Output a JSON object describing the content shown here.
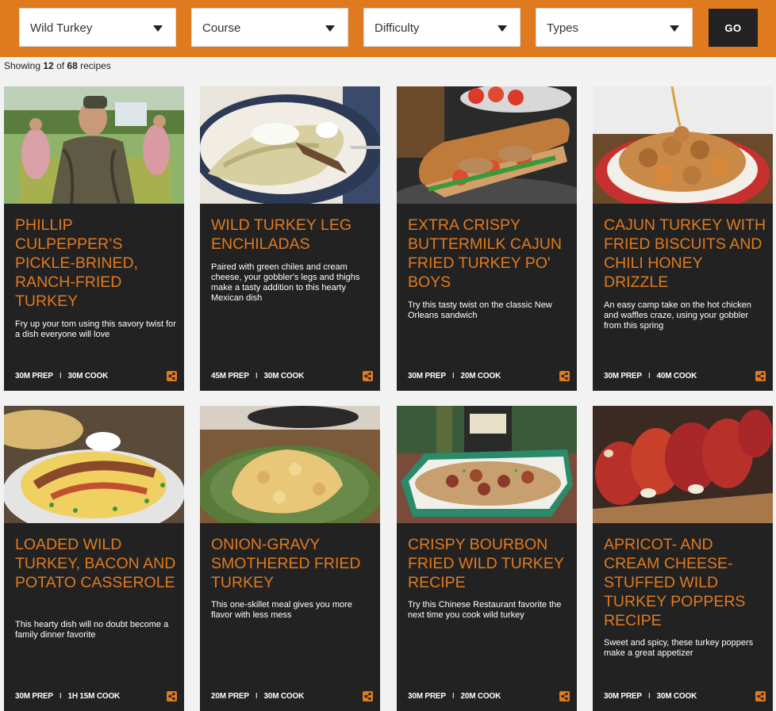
{
  "filters": {
    "species": {
      "value": "Wild Turkey"
    },
    "course": {
      "value": "Course"
    },
    "difficulty": {
      "value": "Difficulty"
    },
    "types": {
      "value": "Types"
    },
    "go_label": "GO"
  },
  "results": {
    "prefix": "Showing ",
    "shown": "12",
    "of": " of ",
    "total": "68",
    "suffix": " recipes"
  },
  "colors": {
    "accent": "#e07a1f",
    "card_bg": "#222222",
    "page_bg": "#f2f2f2"
  },
  "cards": [
    {
      "title": "Phillip Culpepper’s Pickle-Brined, Ranch-Fried Turkey",
      "desc": "Fry up your tom using this savory twist for a dish everyone will love",
      "prep": "30M PREP",
      "cook": "30M COOK",
      "image": "hunter-holding-turkey-legs"
    },
    {
      "title": "Wild Turkey Leg Enchiladas",
      "desc": "Paired with green chiles and cream cheese, your gobbler's legs and thighs make a tasty addition to this hearty Mexican dish",
      "prep": "45M PREP",
      "cook": "30M COOK",
      "image": "enchilada-plate"
    },
    {
      "title": "Extra Crispy Buttermilk Cajun Fried Turkey Po' Boys",
      "desc": "Try this tasty twist on the classic New Orleans sandwich",
      "prep": "30M PREP",
      "cook": "20M COOK",
      "image": "po-boy-sandwich"
    },
    {
      "title": "Cajun Turkey with Fried Biscuits and Chili Honey Drizzle",
      "desc": "An easy camp take on the hot chicken and waffles craze, using your gobbler from this spring",
      "prep": "30M PREP",
      "cook": "40M COOK",
      "image": "fried-turkey-biscuits"
    },
    {
      "title": "Loaded Wild Turkey, Bacon and Potato Casserole",
      "desc": "This hearty dish will no doubt become a family dinner favorite",
      "prep": "30M PREP",
      "cook": "1H 15M COOK",
      "image": "potato-casserole-plate"
    },
    {
      "title": "Onion-Gravy Smothered Fried Turkey",
      "desc": "This one-skillet meal gives you more flavor with less mess",
      "prep": "20M PREP",
      "cook": "30M COOK",
      "image": "smothered-turkey-plate"
    },
    {
      "title": "Crispy Bourbon Fried Wild Turkey Recipe",
      "desc": "Try this Chinese Restaurant favorite the next time you cook wild turkey",
      "prep": "30M PREP",
      "cook": "20M COOK",
      "image": "bourbon-turkey-dish"
    },
    {
      "title": "Apricot- and Cream Cheese-Stuffed Wild Turkey Poppers Recipe",
      "desc": "Sweet and spicy, these turkey poppers make a great appetizer",
      "prep": "30M PREP",
      "cook": "30M COOK",
      "image": "turkey-poppers-tray"
    }
  ]
}
